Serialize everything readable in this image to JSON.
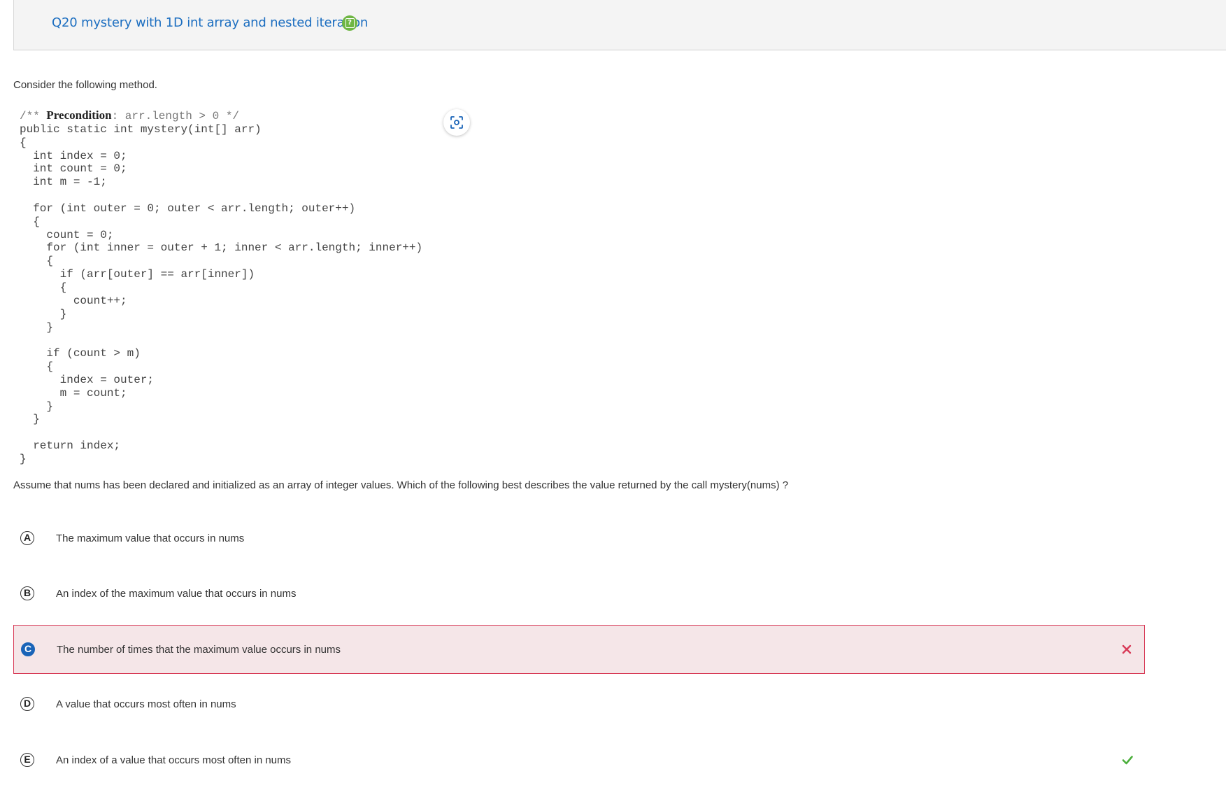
{
  "header": {
    "title": "Q20 mystery with 1D int array and nested iteration",
    "help_icon": "help-icon"
  },
  "intro": "Consider the following method.",
  "code": {
    "comment_open": "/** ",
    "precondition_label": "Precondition",
    "precondition_rest": ": arr.length > 0 */",
    "body": "public static int mystery(int[] arr)\n{\n  int index = 0;\n  int count = 0;\n  int m = -1;\n\n  for (int outer = 0; outer < arr.length; outer++)\n  {\n    count = 0;\n    for (int inner = outer + 1; inner < arr.length; inner++)\n    {\n      if (arr[outer] == arr[inner])\n      {\n        count++;\n      }\n    }\n\n    if (count > m)\n    {\n      index = outer;\n      m = count;\n    }\n  }\n\n  return index;\n}"
  },
  "zoom_icon": "zoom-focus-icon",
  "question": "Assume that nums has been declared and initialized as an array of integer values. Which of the following best describes the value returned by the call mystery(nums) ?",
  "choices": [
    {
      "letter": "A",
      "text": "The maximum value that occurs in nums"
    },
    {
      "letter": "B",
      "text": "An index of the maximum value that occurs in nums"
    },
    {
      "letter": "C",
      "text": "The number of times that the maximum value occurs in nums",
      "selected": true,
      "status": "incorrect"
    },
    {
      "letter": "D",
      "text": "A value that occurs most often in nums"
    },
    {
      "letter": "E",
      "text": "An index of a value that occurs most often in nums",
      "status": "correct"
    }
  ],
  "colors": {
    "title": "#1c6ec0",
    "help_icon": "#6fb644",
    "selected_fill": "#1a64b8",
    "incorrect": "#d83a57",
    "correct": "#4caf3c"
  }
}
